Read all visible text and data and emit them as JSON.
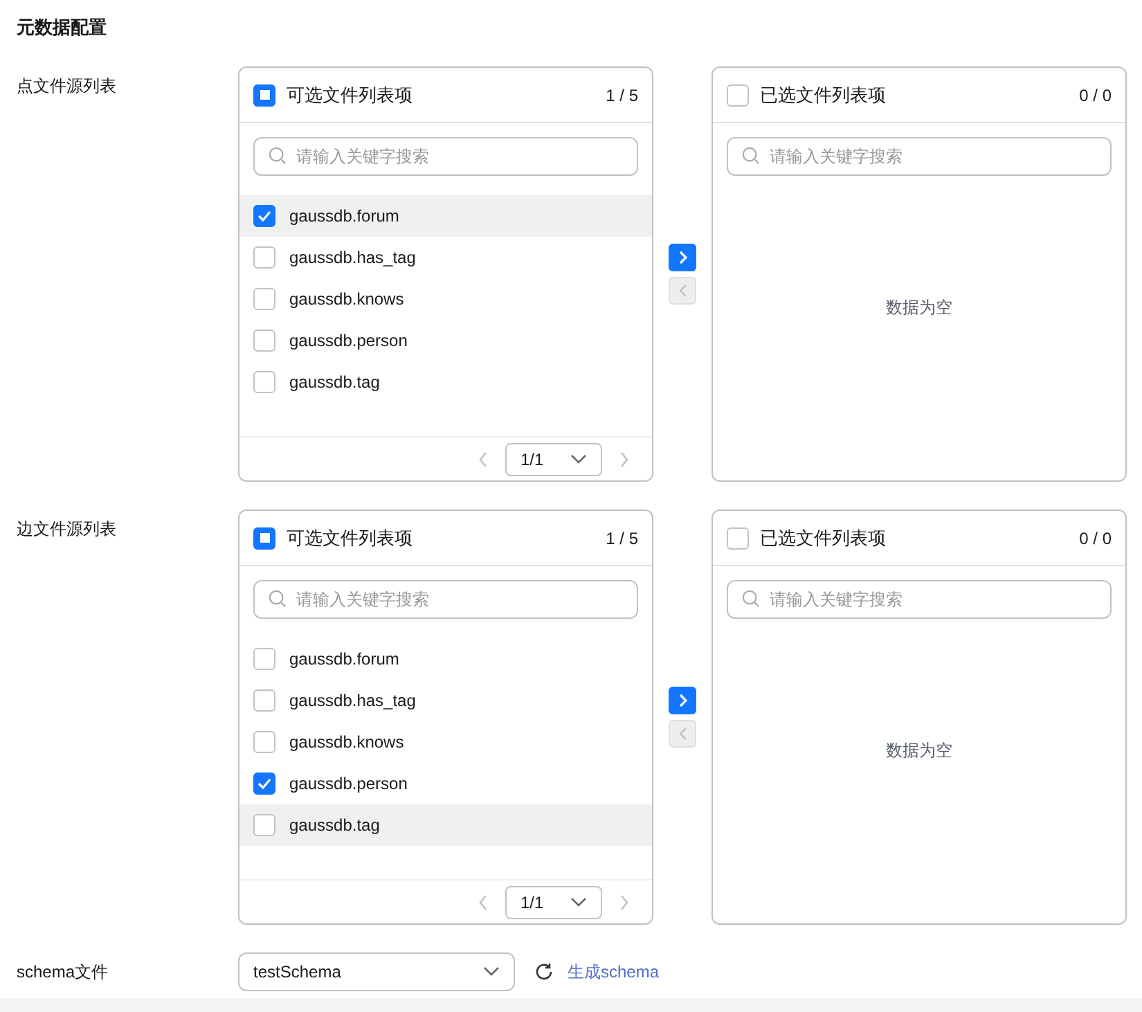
{
  "title": "元数据配置",
  "sections": [
    {
      "label": "点文件源列表",
      "source": {
        "title": "可选文件列表项",
        "count": "1 / 5",
        "all_checked": false,
        "indeterminate": true,
        "placeholder": "请输入关键字搜索",
        "items": [
          {
            "name": "gaussdb.forum",
            "checked": true,
            "hovered": true
          },
          {
            "name": "gaussdb.has_tag",
            "checked": false,
            "hovered": false
          },
          {
            "name": "gaussdb.knows",
            "checked": false,
            "hovered": false
          },
          {
            "name": "gaussdb.person",
            "checked": false,
            "hovered": false
          },
          {
            "name": "gaussdb.tag",
            "checked": false,
            "hovered": false
          }
        ],
        "page": "1/1"
      },
      "to_right_enabled": true,
      "to_left_enabled": false,
      "target": {
        "title": "已选文件列表项",
        "count": "0 / 0",
        "all_checked": false,
        "indeterminate": false,
        "placeholder": "请输入关键字搜索",
        "empty": "数据为空"
      }
    },
    {
      "label": "边文件源列表",
      "source": {
        "title": "可选文件列表项",
        "count": "1 / 5",
        "all_checked": false,
        "indeterminate": true,
        "placeholder": "请输入关键字搜索",
        "items": [
          {
            "name": "gaussdb.forum",
            "checked": false,
            "hovered": false
          },
          {
            "name": "gaussdb.has_tag",
            "checked": false,
            "hovered": false
          },
          {
            "name": "gaussdb.knows",
            "checked": false,
            "hovered": false
          },
          {
            "name": "gaussdb.person",
            "checked": true,
            "hovered": false
          },
          {
            "name": "gaussdb.tag",
            "checked": false,
            "hovered": true
          }
        ],
        "page": "1/1"
      },
      "to_right_enabled": true,
      "to_left_enabled": false,
      "target": {
        "title": "已选文件列表项",
        "count": "0 / 0",
        "all_checked": false,
        "indeterminate": false,
        "placeholder": "请输入关键字搜索",
        "empty": "数据为空"
      }
    }
  ],
  "schema": {
    "label": "schema文件",
    "value": "testSchema",
    "link": "生成schema"
  }
}
